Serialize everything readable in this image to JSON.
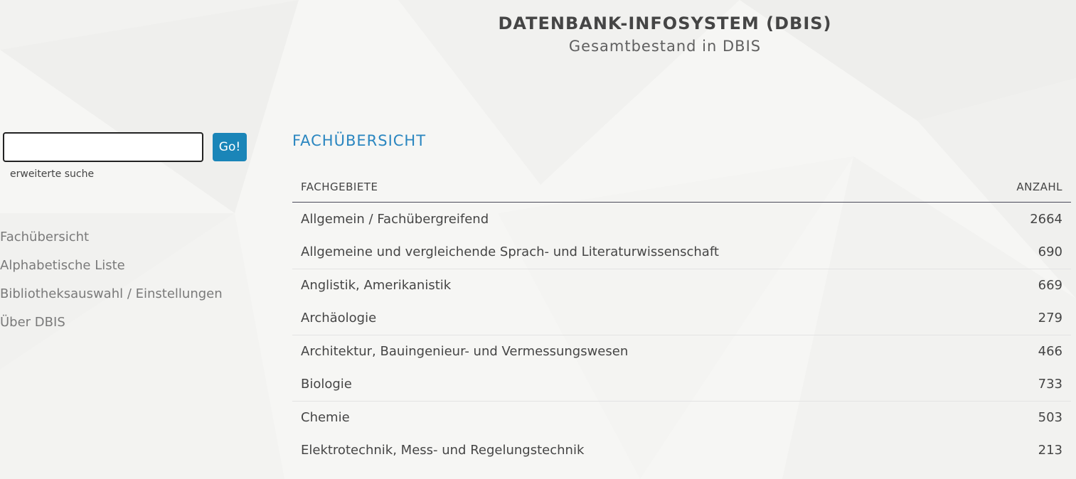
{
  "header": {
    "title": "DATENBANK-INFOSYSTEM (DBIS)",
    "subtitle": "Gesamtbestand in DBIS"
  },
  "search": {
    "value": "",
    "button_label": "Go!",
    "advanced_link": "erweiterte suche"
  },
  "sidebar": {
    "items": [
      {
        "label": "Fachübersicht"
      },
      {
        "label": "Alphabetische Liste"
      },
      {
        "label": "Bibliotheksauswahl / Einstellungen"
      },
      {
        "label": "Über DBIS"
      }
    ]
  },
  "main": {
    "section_title": "FACHÜBERSICHT",
    "columns": {
      "subject": "FACHGEBIETE",
      "count": "ANZAHL"
    },
    "rows": [
      {
        "name": "Allgemein / Fachübergreifend",
        "count": "2664"
      },
      {
        "name": "Allgemeine und vergleichende Sprach- und Literaturwissenschaft",
        "count": "690"
      },
      {
        "name": "Anglistik, Amerikanistik",
        "count": "669"
      },
      {
        "name": "Archäologie",
        "count": "279"
      },
      {
        "name": "Architektur, Bauingenieur- und Vermessungswesen",
        "count": "466"
      },
      {
        "name": "Biologie",
        "count": "733"
      },
      {
        "name": "Chemie",
        "count": "503"
      },
      {
        "name": "Elektrotechnik, Mess- und Regelungstechnik",
        "count": "213"
      }
    ]
  },
  "colors": {
    "accent": "#1a85b8",
    "section_title": "#2a86c0",
    "background": "#f6f6f4"
  }
}
